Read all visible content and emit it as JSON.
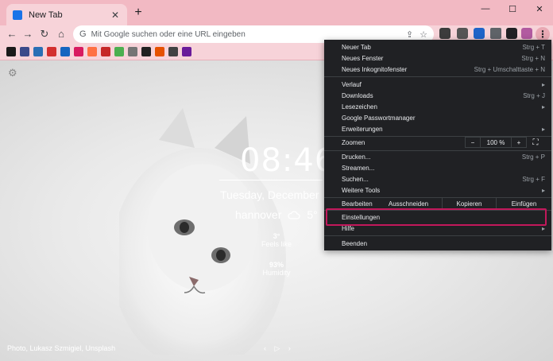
{
  "tab": {
    "title": "New Tab",
    "close": "✕"
  },
  "new_tab": "+",
  "window": {
    "minimize": "—",
    "maximize": "☐",
    "close": "✕"
  },
  "nav": {
    "back": "←",
    "forward": "→",
    "reload": "↻",
    "home": "⌂"
  },
  "omnibox": {
    "placeholder": "Mit Google suchen oder eine URL eingeben"
  },
  "bookmarks": [
    {
      "name": "bm-1",
      "color": "#1a1a1a",
      "glyph": ""
    },
    {
      "name": "bm-2",
      "color": "#3b4a8a",
      "glyph": ""
    },
    {
      "name": "bm-3",
      "color": "#2a6fb5",
      "glyph": ""
    },
    {
      "name": "bm-4",
      "color": "#d32f2f",
      "glyph": ""
    },
    {
      "name": "bm-5",
      "color": "#1565c0",
      "glyph": ""
    },
    {
      "name": "bm-6",
      "color": "#d81b60",
      "glyph": ""
    },
    {
      "name": "bm-7",
      "color": "#ff7043",
      "glyph": ""
    },
    {
      "name": "bm-8",
      "color": "#c62828",
      "glyph": ""
    },
    {
      "name": "bm-9",
      "color": "#4caf50",
      "glyph": ""
    },
    {
      "name": "bm-10",
      "color": "#757575",
      "glyph": ""
    },
    {
      "name": "bm-11",
      "color": "#212121",
      "glyph": ""
    },
    {
      "name": "bm-12",
      "color": "#e65100",
      "glyph": ""
    },
    {
      "name": "bm-13",
      "color": "#424242",
      "glyph": ""
    },
    {
      "name": "bm-14",
      "color": "#6a1b9a",
      "glyph": ""
    }
  ],
  "newtab": {
    "clock": "08:46",
    "date": "Tuesday, December",
    "city": "hannover",
    "temp": "5°",
    "feels_value": "3°",
    "feels_label": "Feels like",
    "humidity_value": "93%",
    "humidity_label": "Humidity",
    "credit": "Photo, Lukasz Szmigiel, Unsplash",
    "credit_nav": "‹ ▷ ›"
  },
  "menu": {
    "neuer_tab": {
      "label": "Neuer Tab",
      "shortcut": "Strg + T"
    },
    "neues_fenster": {
      "label": "Neues Fenster",
      "shortcut": "Strg + N"
    },
    "inkognito": {
      "label": "Neues Inkognitofenster",
      "shortcut": "Strg + Umschalttaste + N"
    },
    "verlauf": {
      "label": "Verlauf"
    },
    "downloads": {
      "label": "Downloads",
      "shortcut": "Strg + J"
    },
    "lesezeichen": {
      "label": "Lesezeichen"
    },
    "passwort": {
      "label": "Google Passwortmanager"
    },
    "erweiterungen": {
      "label": "Erweiterungen"
    },
    "zoomen": {
      "label": "Zoomen",
      "minus": "−",
      "value": "100 %",
      "plus": "+",
      "fullscreen": "⛶"
    },
    "drucken": {
      "label": "Drucken...",
      "shortcut": "Strg + P"
    },
    "streamen": {
      "label": "Streamen..."
    },
    "suchen": {
      "label": "Suchen...",
      "shortcut": "Strg + F"
    },
    "weitere_tools": {
      "label": "Weitere Tools"
    },
    "bearbeiten": {
      "label": "Bearbeiten",
      "cut": "Ausschneiden",
      "copy": "Kopieren",
      "paste": "Einfügen"
    },
    "einstellungen": {
      "label": "Einstellungen"
    },
    "hilfe": {
      "label": "Hilfe"
    },
    "beenden": {
      "label": "Beenden"
    }
  }
}
